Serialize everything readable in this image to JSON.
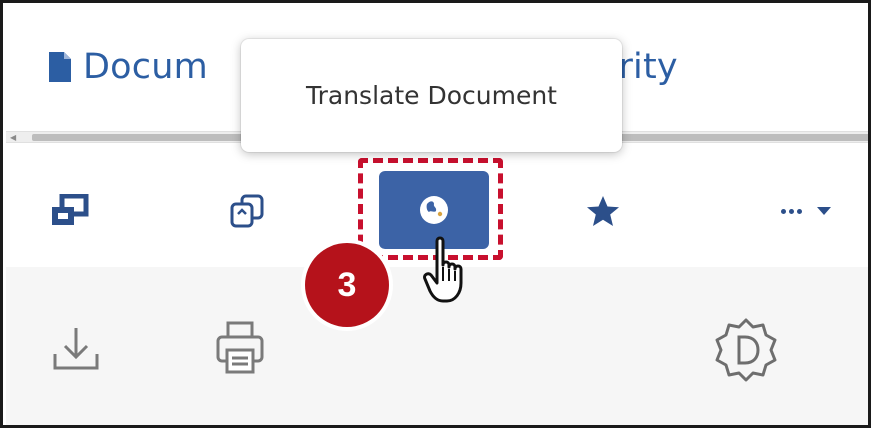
{
  "tabs": {
    "document": {
      "label": "Docum",
      "icon": "document-icon"
    },
    "security": {
      "label": "ge Security",
      "icon": "shield-icon"
    }
  },
  "tooltip": {
    "text": "Translate Document"
  },
  "toolbar": {
    "items": [
      {
        "name": "split-view",
        "icon": "split-view-icon"
      },
      {
        "name": "copy",
        "icon": "copy-icon"
      },
      {
        "name": "translate",
        "icon": "globe-icon",
        "active": true
      },
      {
        "name": "favorite",
        "icon": "star-icon"
      },
      {
        "name": "more",
        "icon": "more-dots-icon"
      }
    ]
  },
  "lower_toolbar": {
    "items": [
      {
        "name": "download",
        "icon": "download-icon"
      },
      {
        "name": "print",
        "icon": "printer-icon"
      },
      {
        "name": "badge",
        "icon": "gear-badge-d-icon"
      }
    ]
  },
  "annotation": {
    "step": "3",
    "color": "#b5121b"
  },
  "colors": {
    "accent": "#2c5ea3",
    "button_bg": "#3c63a6",
    "highlight": "#c8102e"
  }
}
